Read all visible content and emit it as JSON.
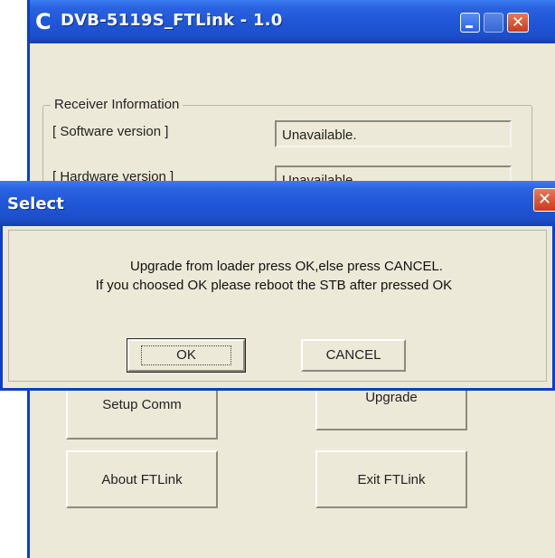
{
  "main_window": {
    "title": "DVB-5119S_FTLink - 1.0",
    "app_icon": "C",
    "close_glyph": "✕"
  },
  "receiver_info": {
    "legend": "Receiver Information",
    "rows": [
      {
        "label": "[ Software version ]",
        "value": "Unavailable."
      },
      {
        "label": "[ Hardware version ]",
        "value": "Unavailable."
      }
    ]
  },
  "actions": {
    "setup_comm": "Setup Comm",
    "upgrade": "Upgrade",
    "about": "About FTLink",
    "exit": "Exit FTLink"
  },
  "dialog": {
    "title": "Select",
    "close_glyph": "✕",
    "message_line_1": "Upgrade from loader press OK,else press CANCEL.",
    "message_line_2": "If you choosed OK please reboot the STB after pressed OK",
    "ok_label": "OK",
    "cancel_label": "CANCEL"
  },
  "icons": {
    "app": "app-logo-icon",
    "minimize": "minimize-icon",
    "maximize": "maximize-icon",
    "close": "close-icon"
  },
  "colors": {
    "titlebar": "#1f55d6",
    "window_bg": "#ece9d8",
    "close_button": "#c83c1c"
  }
}
